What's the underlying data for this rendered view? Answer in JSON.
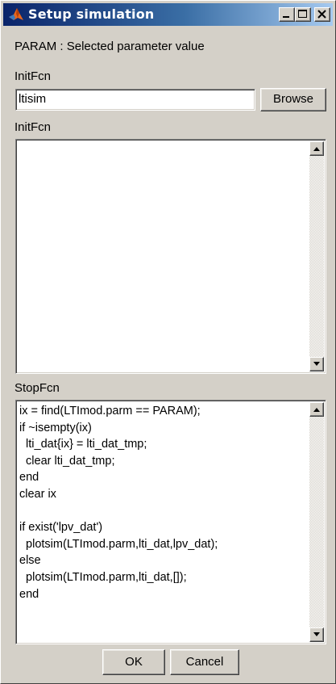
{
  "window": {
    "title": "Setup simulation",
    "controls": {
      "minimize": "minimize-icon",
      "maximize": "maximize-icon",
      "close": "close-icon"
    }
  },
  "param_label": "PARAM :  Selected parameter value",
  "initfcn_file": {
    "label": "InitFcn",
    "value": "ltisim",
    "browse_label": "Browse"
  },
  "initfcn_code": {
    "label": "InitFcn",
    "lines": []
  },
  "stopfcn_code": {
    "label": "StopFcn",
    "lines": [
      "ix = find(LTImod.parm == PARAM);",
      "if ~isempty(ix)",
      "  lti_dat{ix} = lti_dat_tmp;",
      "  clear lti_dat_tmp;",
      "end",
      "clear ix",
      "",
      "if exist('lpv_dat')",
      "  plotsim(LTImod.parm,lti_dat,lpv_dat);",
      "else",
      "  plotsim(LTImod.parm,lti_dat,[]);",
      "end"
    ]
  },
  "buttons": {
    "ok": "OK",
    "cancel": "Cancel"
  },
  "colors": {
    "titlebar_start": "#0a246a",
    "titlebar_end": "#a6caf0",
    "face": "#d4d0c8",
    "matlab_icon": "#e8661c"
  }
}
